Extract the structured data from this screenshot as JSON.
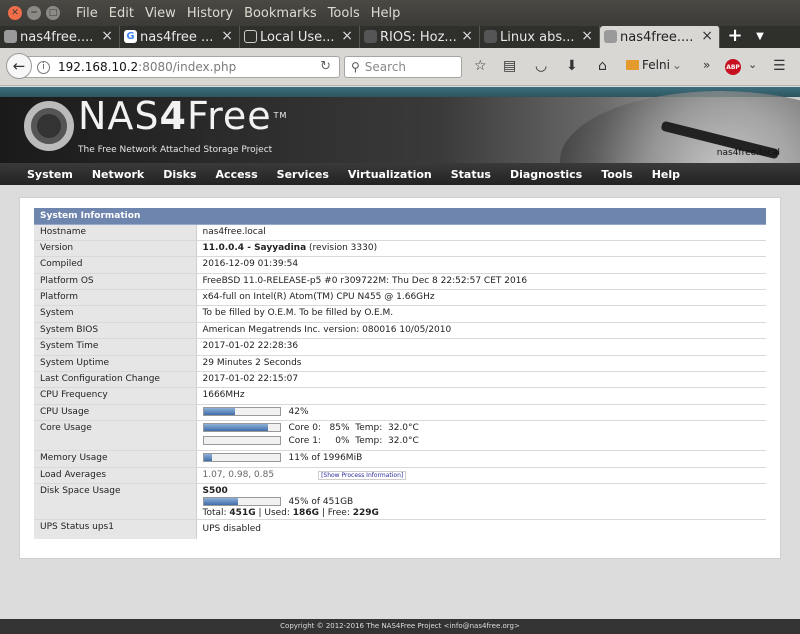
{
  "window": {
    "menus": [
      "File",
      "Edit",
      "View",
      "History",
      "Bookmarks",
      "Tools",
      "Help"
    ]
  },
  "tabs": [
    {
      "label": "nas4free....",
      "icon": "nas4free-favicon",
      "active": false
    },
    {
      "label": "nas4free ...",
      "icon": "google-favicon",
      "active": false
    },
    {
      "label": "Local Use...",
      "icon": "generic-favicon",
      "active": false
    },
    {
      "label": "RIOS: Hoz...",
      "icon": "dark-favicon",
      "active": false
    },
    {
      "label": "Linux abs...",
      "icon": "dark-favicon",
      "active": false
    },
    {
      "label": "nas4free....",
      "icon": "nas4free-favicon",
      "active": true
    }
  ],
  "navbar": {
    "url_host": "192.168.10.2",
    "url_rest": ":8080/index.php",
    "search_placeholder": "Search",
    "bookmark_folder": "Felni"
  },
  "banner": {
    "logo_nas": "NAS",
    "logo_four": "4",
    "logo_free": "Free",
    "logo_tm": "TM",
    "tagline": "The Free Network Attached Storage Project",
    "hostname_label": "nas4free.local"
  },
  "main_menu": [
    "System",
    "Network",
    "Disks",
    "Access",
    "Services",
    "Virtualization",
    "Status",
    "Diagnostics",
    "Tools",
    "Help"
  ],
  "system_info": {
    "title": "System Information",
    "hostname_label": "Hostname",
    "hostname": "nas4free.local",
    "version_label": "Version",
    "version_bold": "11.0.0.4 - Sayyadina",
    "version_rest": " (revision 3330)",
    "compiled_label": "Compiled",
    "compiled": "2016-12-09 01:39:54",
    "platform_os_label": "Platform OS",
    "platform_os": "FreeBSD 11.0-RELEASE-p5 #0 r309722M: Thu Dec 8 22:52:57 CET 2016",
    "platform_label": "Platform",
    "platform": "x64-full on Intel(R) Atom(TM) CPU N455 @ 1.66GHz",
    "system_label": "System",
    "system": "To be filled by O.E.M. To be filled by O.E.M.",
    "bios_label": "System BIOS",
    "bios": "American Megatrends Inc. version: 080016 10/05/2010",
    "time_label": "System Time",
    "time": "2017-01-02 22:28:36",
    "uptime_label": "System Uptime",
    "uptime": "29 Minutes 2 Seconds",
    "last_config_label": "Last Configuration Change",
    "last_config": "2017-01-02 22:15:07",
    "cpu_freq_label": "CPU Frequency",
    "cpu_freq": "1666MHz",
    "cpu_usage_label": "CPU Usage",
    "cpu_usage_text": "42%",
    "cpu_usage_fraction": 0.42,
    "core_usage_label": "Core Usage",
    "cores": [
      {
        "text": "Core 0:   85%  Temp:  32.0°C",
        "fraction": 0.85
      },
      {
        "text": "Core 1:     0%  Temp:  32.0°C",
        "fraction": 0.0
      }
    ],
    "memory_label": "Memory Usage",
    "memory_text": "11% of 1996MiB",
    "memory_fraction": 0.11,
    "load_label": "Load Averages",
    "load": "1.07, 0.98, 0.85",
    "process_link": "[Show Process Information]",
    "disk_label": "Disk Space Usage",
    "disk_name": "S500",
    "disk_text": "45% of 451GB",
    "disk_fraction": 0.45,
    "disk_total_label": "Total: ",
    "disk_total": "451G",
    "disk_used_label": " | Used: ",
    "disk_used": "186G",
    "disk_free_label": " | Free: ",
    "disk_free": "229G",
    "ups_label": "UPS Status ups1",
    "ups": "UPS disabled"
  },
  "footer": "Copyright © 2012-2016 The NAS4Free Project <info@nas4free.org>"
}
